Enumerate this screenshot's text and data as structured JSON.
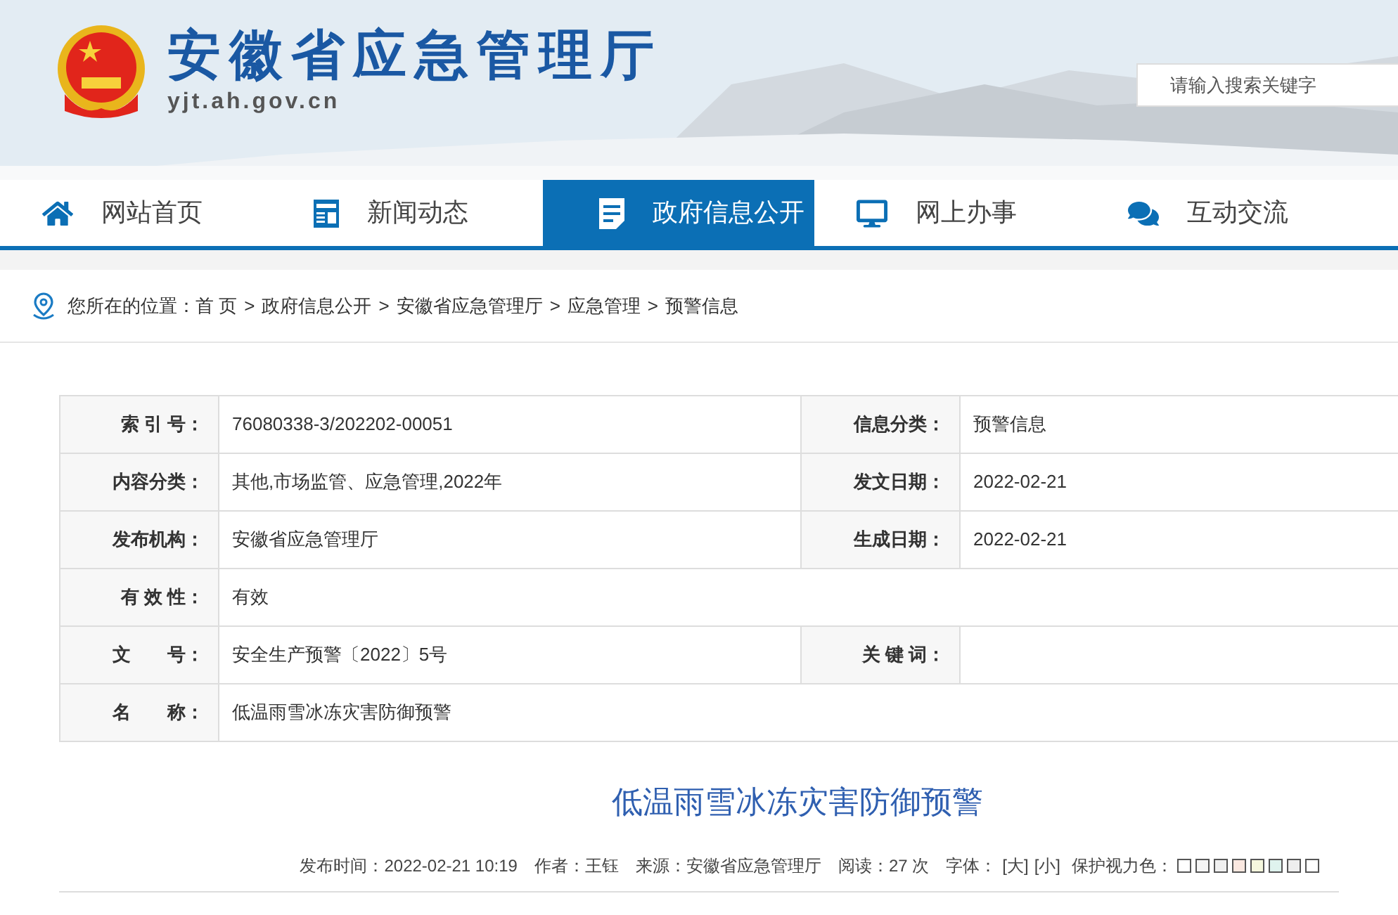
{
  "header": {
    "title": "安徽省应急管理厅",
    "domain": "yjt.ah.gov.cn",
    "search": {
      "placeholder": "请输入搜索关键字"
    }
  },
  "nav": [
    {
      "label": "网站首页",
      "kind": "home",
      "selected": false
    },
    {
      "label": "新闻动态",
      "kind": "news",
      "selected": false
    },
    {
      "label": "政府信息公开",
      "kind": "doc",
      "selected": true
    },
    {
      "label": "网上办事",
      "kind": "monitor",
      "selected": false
    },
    {
      "label": "互动交流",
      "kind": "chat",
      "selected": false
    }
  ],
  "breadcrumb": {
    "label": "您所在的位置：",
    "items": [
      {
        "text": "首 页"
      },
      {
        "sep": ">",
        "text": "政府信息公开"
      },
      {
        "sep": ">",
        "text": "安徽省应急管理厅"
      },
      {
        "sep": ">",
        "text": "应急管理"
      },
      {
        "sep": ">",
        "text": "预警信息"
      }
    ]
  },
  "info_table": [
    {
      "cells": [
        {
          "label": "索 引 号：",
          "value": "76080338-3/202202-00051"
        },
        {
          "label": "信息分类：",
          "value": "预警信息"
        }
      ]
    },
    {
      "cells": [
        {
          "label": "内容分类：",
          "value": "其他,市场监管、应急管理,2022年"
        },
        {
          "label": "发文日期：",
          "value": "2022-02-21"
        }
      ]
    },
    {
      "cells": [
        {
          "label": "发布机构：",
          "value": "安徽省应急管理厅"
        },
        {
          "label": "生成日期：",
          "value": "2022-02-21"
        }
      ]
    },
    {
      "cells": [
        {
          "label": "有 效 性：",
          "value": "有效"
        }
      ]
    },
    {
      "cells": [
        {
          "label": "文　　号：",
          "value": "安全生产预警〔2022〕5号"
        },
        {
          "label": "关 键 词："
        }
      ]
    },
    {
      "cells": [
        {
          "label": "名　　称：",
          "value": "低温雨雪冰冻灾害防御预警"
        }
      ]
    }
  ],
  "article": {
    "title": "低温雨雪冰冻灾害防御预警",
    "meta": [
      {
        "label": "发布时间：",
        "value": "2022-02-21 10:19"
      },
      {
        "label": "作者：",
        "value": "王钰"
      },
      {
        "label": "来源：",
        "value": "安徽省应急管理厅"
      },
      {
        "label": "阅读：",
        "value": "27 次"
      }
    ],
    "font_size": {
      "label": "字体：",
      "options": [
        "[大]",
        "[小]"
      ]
    },
    "eye_care": {
      "label": "保护视力色：",
      "colors": [
        {
          "color": "#ffffff"
        },
        {
          "color": "#f5f5f5"
        },
        {
          "color": "#f0f0f0"
        },
        {
          "color": "#fbe8e0"
        },
        {
          "color": "#f6f8de"
        },
        {
          "color": "#dff3ee"
        },
        {
          "color": "#eeeeee"
        },
        {
          "color": "#ffffff"
        }
      ]
    }
  }
}
